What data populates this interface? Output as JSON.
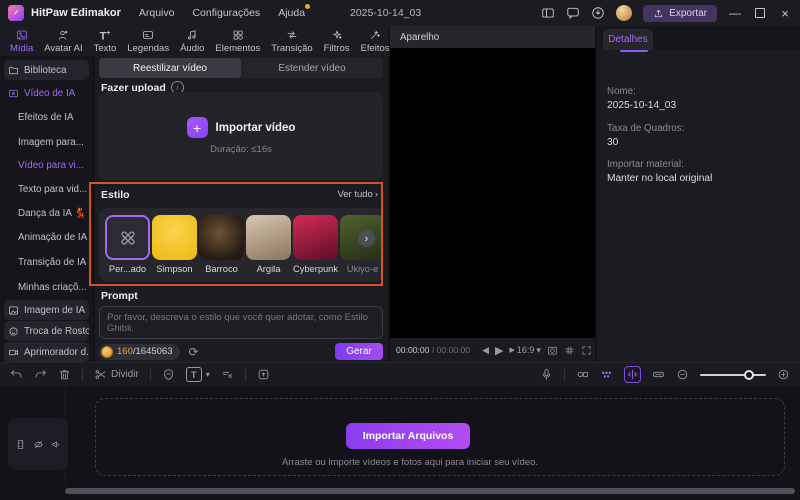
{
  "titlebar": {
    "app_name": "HitPaw Edimakor",
    "menu_arquivo": "Arquivo",
    "menu_configuracoes": "Configurações",
    "menu_ajuda": "Ajuda",
    "project_title": "2025-10-14_03",
    "export_label": "Exportar"
  },
  "ribbon": {
    "tabs": [
      {
        "label": "Mídia",
        "active": true
      },
      {
        "label": "Avatar AI",
        "active": false
      },
      {
        "label": "Texto",
        "active": false
      },
      {
        "label": "Legendas",
        "active": false
      },
      {
        "label": "Áudio",
        "active": false
      },
      {
        "label": "Elementos",
        "active": false
      },
      {
        "label": "Transição",
        "active": false
      },
      {
        "label": "Filtros",
        "active": false
      },
      {
        "label": "Efeitos",
        "active": false
      }
    ]
  },
  "sidebar": {
    "items": [
      {
        "label": "Biblioteca",
        "active": false
      },
      {
        "label": "Vídeo de IA",
        "active": true
      },
      {
        "label": "Efeitos de IA",
        "active": false
      },
      {
        "label": "Imagem para...",
        "active": false
      },
      {
        "label": "Vídeo para vi...",
        "active": true
      },
      {
        "label": "Texto para vid...",
        "active": false
      },
      {
        "label": "Dança da IA 💃",
        "active": false
      },
      {
        "label": "Animação de IA",
        "active": false
      },
      {
        "label": "Transição de IA",
        "active": false
      },
      {
        "label": "Minhas criaçõ...",
        "active": false
      },
      {
        "label": "Imagem de IA",
        "active": false
      },
      {
        "label": "Troca de Rostos",
        "active": false
      },
      {
        "label": "Aprimorador d...",
        "active": false
      }
    ]
  },
  "main": {
    "tab_restyle": "Reestilizar vídeo",
    "tab_extend": "Estender vídeo",
    "upload_title": "Fazer upload",
    "import_video": "Importar vídeo",
    "duration_hint": "Duração: ≤16s",
    "style_title": "Estilo",
    "see_all": "Ver tudo",
    "styles": [
      {
        "label": "Per...ado",
        "selected": true
      },
      {
        "label": "Simpson",
        "selected": false
      },
      {
        "label": "Barroco",
        "selected": false
      },
      {
        "label": "Argila",
        "selected": false
      },
      {
        "label": "Cyberpunk",
        "selected": false
      },
      {
        "label": "Ukiyo-e",
        "selected": false
      }
    ],
    "prompt_title": "Prompt",
    "prompt_placeholder": "Por favor, descreva o estilo que você quer adotar, como Estilo Ghibli.",
    "credits_used": "160",
    "credits_sep": "/",
    "credits_total": "1645063",
    "generate_label": "Gerar"
  },
  "preview": {
    "title": "Aparelho",
    "current_time": "00:00:00",
    "time_sep": "/",
    "total_time": "00:00:00",
    "aspect_ratio": "16:9"
  },
  "details": {
    "tab_label": "Detalhes",
    "fields": [
      {
        "label": "Nome:",
        "value": "2025-10-14_03"
      },
      {
        "label": "Taxa de Quadros:",
        "value": "30"
      },
      {
        "label": "Importar material:",
        "value": "Manter no local original"
      }
    ]
  },
  "toolbar": {
    "split_label": "Dividir"
  },
  "timeline": {
    "import_button": "Importar Arquivos",
    "drop_hint": "Arraste ou importe vídeos e fotos aqui para iniciar seu vídeo."
  },
  "colors": {
    "accent_purple": "#a06af5",
    "highlight_border": "#d9502e",
    "generate_gradient": "#7b3bee → #a44cf2",
    "import_gradient": "#8a3cf0 → #b44cf2",
    "simpson_yellow": "#f2c114",
    "cyberpunk_red": "#c2244e",
    "coin_orange": "#e8a33d",
    "notification_dot": "#f0a030"
  }
}
